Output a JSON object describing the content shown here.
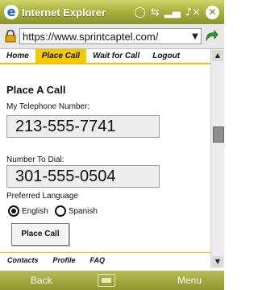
{
  "titlebar": {
    "app_title": "Internet Explorer"
  },
  "address": {
    "url": "https://www.sprintcaptel.com/"
  },
  "topnav": {
    "items": [
      "Home",
      "Place Call",
      "Wait for Call",
      "Logout"
    ],
    "active_index": 1
  },
  "page": {
    "title": "Place A Call"
  },
  "form": {
    "my_phone_label": "My Telephone Number:",
    "my_phone_value": "213-555-7741",
    "dial_label": "Number To Dial:",
    "dial_value": "301-555-0504",
    "language_label": "Preferred Language",
    "languages": [
      "English",
      "Spanish"
    ],
    "selected_language": "English",
    "place_call_label": "Place Call"
  },
  "bottomnav": {
    "items": [
      "Contacts",
      "Profile",
      "FAQ"
    ]
  },
  "softkeys": {
    "left": "Back",
    "right": "Menu"
  },
  "colors": {
    "accent_yellow": "#f4c900",
    "chrome_olive": "#a9b23f"
  }
}
